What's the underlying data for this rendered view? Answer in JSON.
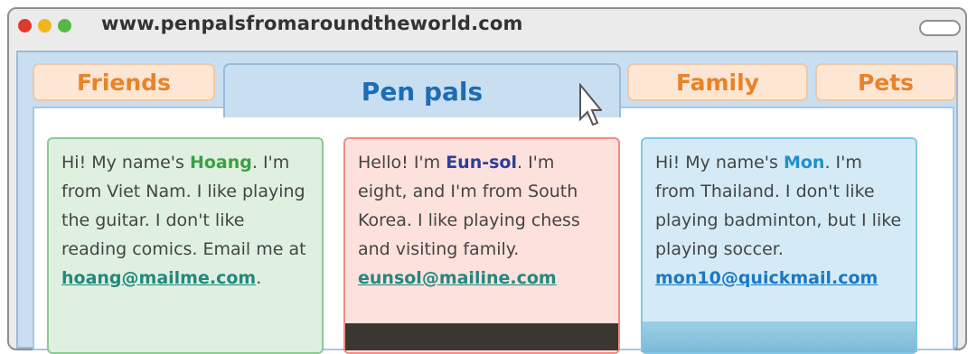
{
  "browser": {
    "url": "www.penpalsfromaroundtheworld.com"
  },
  "tabs": [
    {
      "label": "Friends"
    },
    {
      "label": "Pen pals",
      "active": true
    },
    {
      "label": "Family"
    },
    {
      "label": "Pets"
    }
  ],
  "cards": {
    "hoang": {
      "intro": "Hi! My name's ",
      "name": "Hoang",
      "text": ". I'm from Viet Nam. I like playing the guitar. I don't like reading comics. Email me at ",
      "email": "hoang@mailme.com",
      "end": "."
    },
    "eunsol": {
      "intro": "Hello! I'm ",
      "name": "Eun-sol",
      "text": ". I'm eight, and I'm from South Korea. I like playing chess and visiting family.",
      "email": "eunsol@mailine.com"
    },
    "mon": {
      "intro": "Hi! My name's ",
      "name": "Mon",
      "text": ". I'm from Thailand. I don't like playing badminton, but I like playing soccer.",
      "email": "mon10@quickmail.com"
    }
  },
  "colors": {
    "tab_text": "#e8832a",
    "active_tab_text": "#1e6cb5",
    "card_green": "#dff0e0",
    "card_pink": "#fde1dd",
    "card_blue": "#d4ebf7"
  }
}
